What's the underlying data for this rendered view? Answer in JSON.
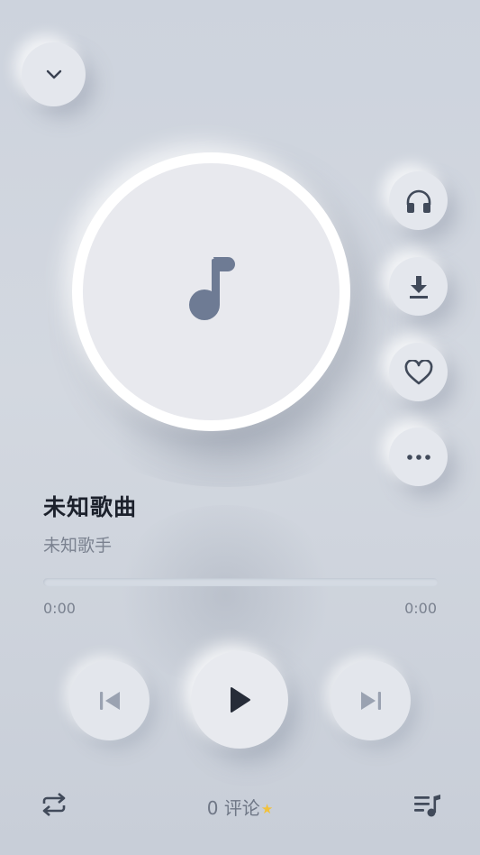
{
  "song": {
    "title": "未知歌曲",
    "artist": "未知歌手"
  },
  "progress": {
    "current": "0:00",
    "total": "0:00",
    "fraction": 0
  },
  "comments": {
    "count": "0",
    "label": "评论",
    "star": "★"
  },
  "colors": {
    "background": "#cdd3dd",
    "button": "#e4e7ed",
    "icon": "#414a5a",
    "note": "#6e7b94",
    "star": "#f2c23c"
  },
  "icons": {
    "back": "chevron-down-icon",
    "side": [
      "headphones-icon",
      "download-icon",
      "heart-icon",
      "more-icon"
    ],
    "controls": [
      "skip-previous-icon",
      "play-icon",
      "skip-next-icon"
    ],
    "bottom": [
      "repeat-icon",
      "playlist-icon"
    ],
    "cover": "music-note-icon"
  }
}
